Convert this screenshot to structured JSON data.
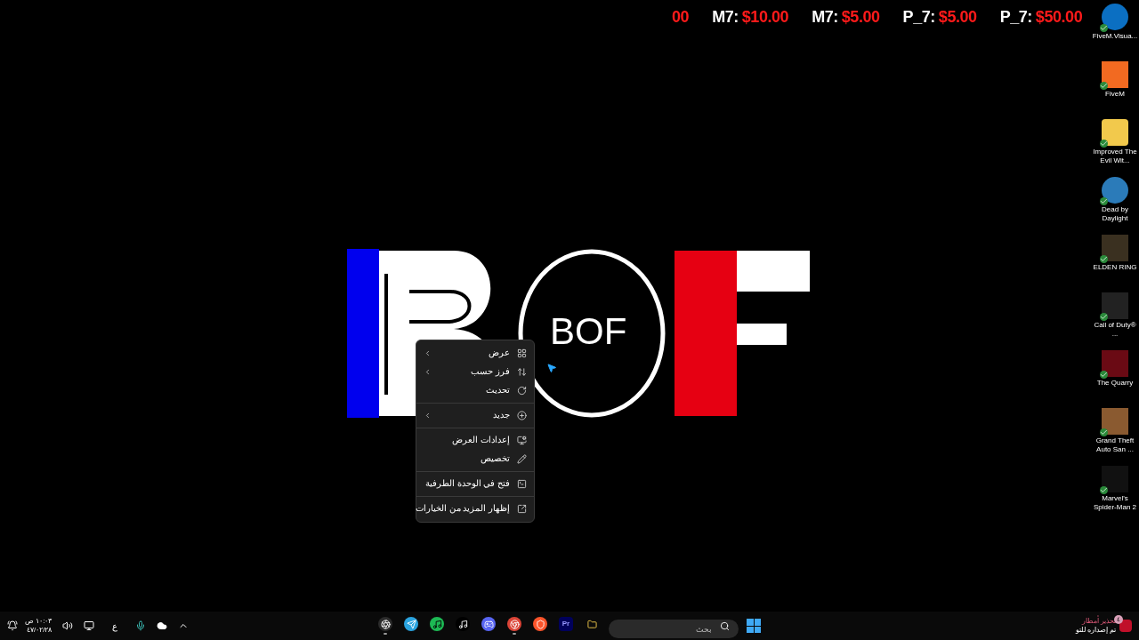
{
  "ticker": [
    {
      "label": "P_7: ",
      "price": "$50.00"
    },
    {
      "label": "P_7: ",
      "price": "$5.00"
    },
    {
      "label": "M7: ",
      "price": "$5.00"
    },
    {
      "label": "M7: ",
      "price": "$10.00"
    },
    {
      "price": "00"
    }
  ],
  "logo": {
    "inner": "BOF"
  },
  "desktop_icons": [
    {
      "label": "FiveM.Visua..."
    },
    {
      "label": "FiveM"
    },
    {
      "label": "Improved The Evil Wit..."
    },
    {
      "label": "Dead by Daylight"
    },
    {
      "label": "ELDEN RING"
    },
    {
      "label": "Call of Duty® ..."
    },
    {
      "label": "The Quarry"
    },
    {
      "label": "Grand Theft Auto San ..."
    },
    {
      "label": "Marvel's Spider-Man 2"
    }
  ],
  "context_menu": [
    {
      "kind": "item",
      "label": "عرض",
      "submenu": true
    },
    {
      "kind": "item",
      "label": "فرز حسب",
      "submenu": true
    },
    {
      "kind": "item",
      "label": "تحديث",
      "submenu": false
    },
    {
      "kind": "separator"
    },
    {
      "kind": "item",
      "label": "جديد",
      "submenu": true
    },
    {
      "kind": "separator"
    },
    {
      "kind": "item",
      "label": "إعدادات العرض",
      "submenu": false
    },
    {
      "kind": "item",
      "label": "تخصيص",
      "submenu": false
    },
    {
      "kind": "separator"
    },
    {
      "kind": "item",
      "label": "فتح في الوحدة الطرفية",
      "submenu": false
    },
    {
      "kind": "separator"
    },
    {
      "kind": "item",
      "label": "إظهار المزيد من الخيارات",
      "submenu": false
    }
  ],
  "taskbar": {
    "tray": {
      "time": "١٠:٠٣ ص",
      "date": "٤٧/٠٢/٢٨",
      "language": "ع"
    },
    "apps": [
      {
        "running": true
      },
      {
        "running": false
      },
      {
        "running": false
      },
      {
        "running": false
      },
      {
        "running": false
      },
      {
        "running": true
      },
      {
        "running": false
      },
      {
        "running": false,
        "label": "Pr"
      },
      {
        "running": false
      }
    ],
    "search": {
      "placeholder": "بحث"
    },
    "weather": {
      "title": "تحذير أمطار",
      "subtitle": "تم إصداره للتو",
      "badge": "٤"
    }
  }
}
